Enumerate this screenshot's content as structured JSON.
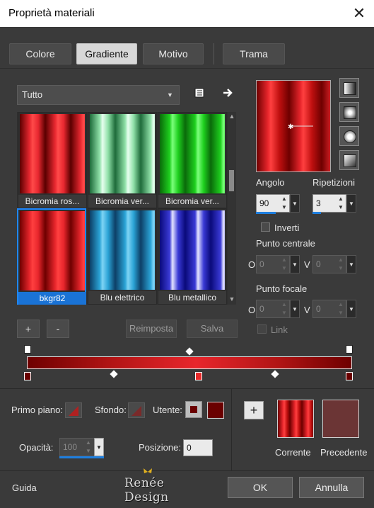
{
  "window": {
    "title": "Proprietà materiali",
    "close_glyph": "✕"
  },
  "tabs": [
    {
      "label": "Colore"
    },
    {
      "label": "Gradiente"
    },
    {
      "label": "Motivo"
    },
    {
      "label": "Trama"
    }
  ],
  "filter": {
    "selected": "Tutto"
  },
  "gallery": {
    "items": [
      {
        "label": "Bicromia ros...",
        "palette": [
          "#5a0000",
          "#e82830",
          "#ff4a4a"
        ]
      },
      {
        "label": "Bicromia ver...",
        "palette": [
          "#1e6b3a",
          "#8fe0a8",
          "#e8fff0"
        ]
      },
      {
        "label": "Bicromia ver...",
        "palette": [
          "#0a6a0a",
          "#1ed01e",
          "#7cff7c"
        ]
      },
      {
        "label": "bkgr82",
        "palette": [
          "#6e0000",
          "#e8262c",
          "#ff4040"
        ]
      },
      {
        "label": "Blu elettrico",
        "palette": [
          "#0d3f66",
          "#2aa3d6",
          "#7fd4f5"
        ]
      },
      {
        "label": "Blu metallico",
        "palette": [
          "#0a0a7a",
          "#3a3ad6",
          "#e6e6ff"
        ]
      }
    ]
  },
  "angle": {
    "label": "Angolo",
    "value": "90"
  },
  "repeats": {
    "label": "Ripetizioni",
    "value": "3"
  },
  "invert": {
    "label": "Inverti"
  },
  "center_point": {
    "label": "Punto centrale",
    "x_label": "O",
    "x_value": "0",
    "y_label": "V",
    "y_value": "0"
  },
  "focal_point": {
    "label": "Punto focale",
    "x_label": "O",
    "x_value": "0",
    "y_label": "V",
    "y_value": "0"
  },
  "link": {
    "label": "Link"
  },
  "buttons": {
    "add": "+",
    "remove": "-",
    "reset": "Reimposta",
    "save": "Salva"
  },
  "stops": {
    "primary_label": "Primo piano:",
    "background_label": "Sfondo:",
    "user_label": "Utente:",
    "user_color": "#6a0000",
    "opacity_label": "Opacità:",
    "opacity_value": "100",
    "position_label": "Posizione:",
    "position_value": "0"
  },
  "compare": {
    "add_glyph": "+",
    "current_label": "Corrente",
    "previous_label": "Precedente",
    "previous_color": "#6b3535"
  },
  "footer": {
    "help": "Guida",
    "ok": "OK",
    "cancel": "Annulla",
    "watermark": "Renée Design"
  }
}
